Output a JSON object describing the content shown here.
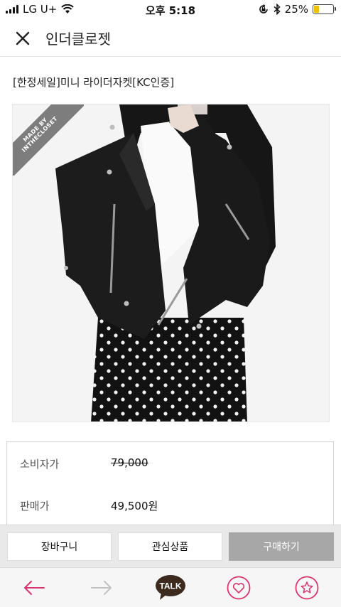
{
  "status_bar": {
    "carrier": "LG U+",
    "time": "오후 5:18",
    "battery_percent": "25%",
    "battery_level": 0.25
  },
  "header": {
    "title": "인더클로젯"
  },
  "product": {
    "name": "[한정세일]미니 라이더자켓[KC인증]",
    "badge_line1": "MADE BY",
    "badge_line2": "INTHECLOSET"
  },
  "price": {
    "consumer_label": "소비자가",
    "consumer_value": "79,000",
    "sale_label": "판매가",
    "sale_value": "49,500원"
  },
  "actions": {
    "cart": "장바구니",
    "wishlist": "관심상품",
    "buy": "구매하기"
  },
  "nav": {
    "talk": "TALK"
  },
  "colors": {
    "accent": "#d6356f",
    "buy_button": "#a7a7a7",
    "talk_bubble": "#3c2a1e",
    "battery": "#f2c200"
  }
}
